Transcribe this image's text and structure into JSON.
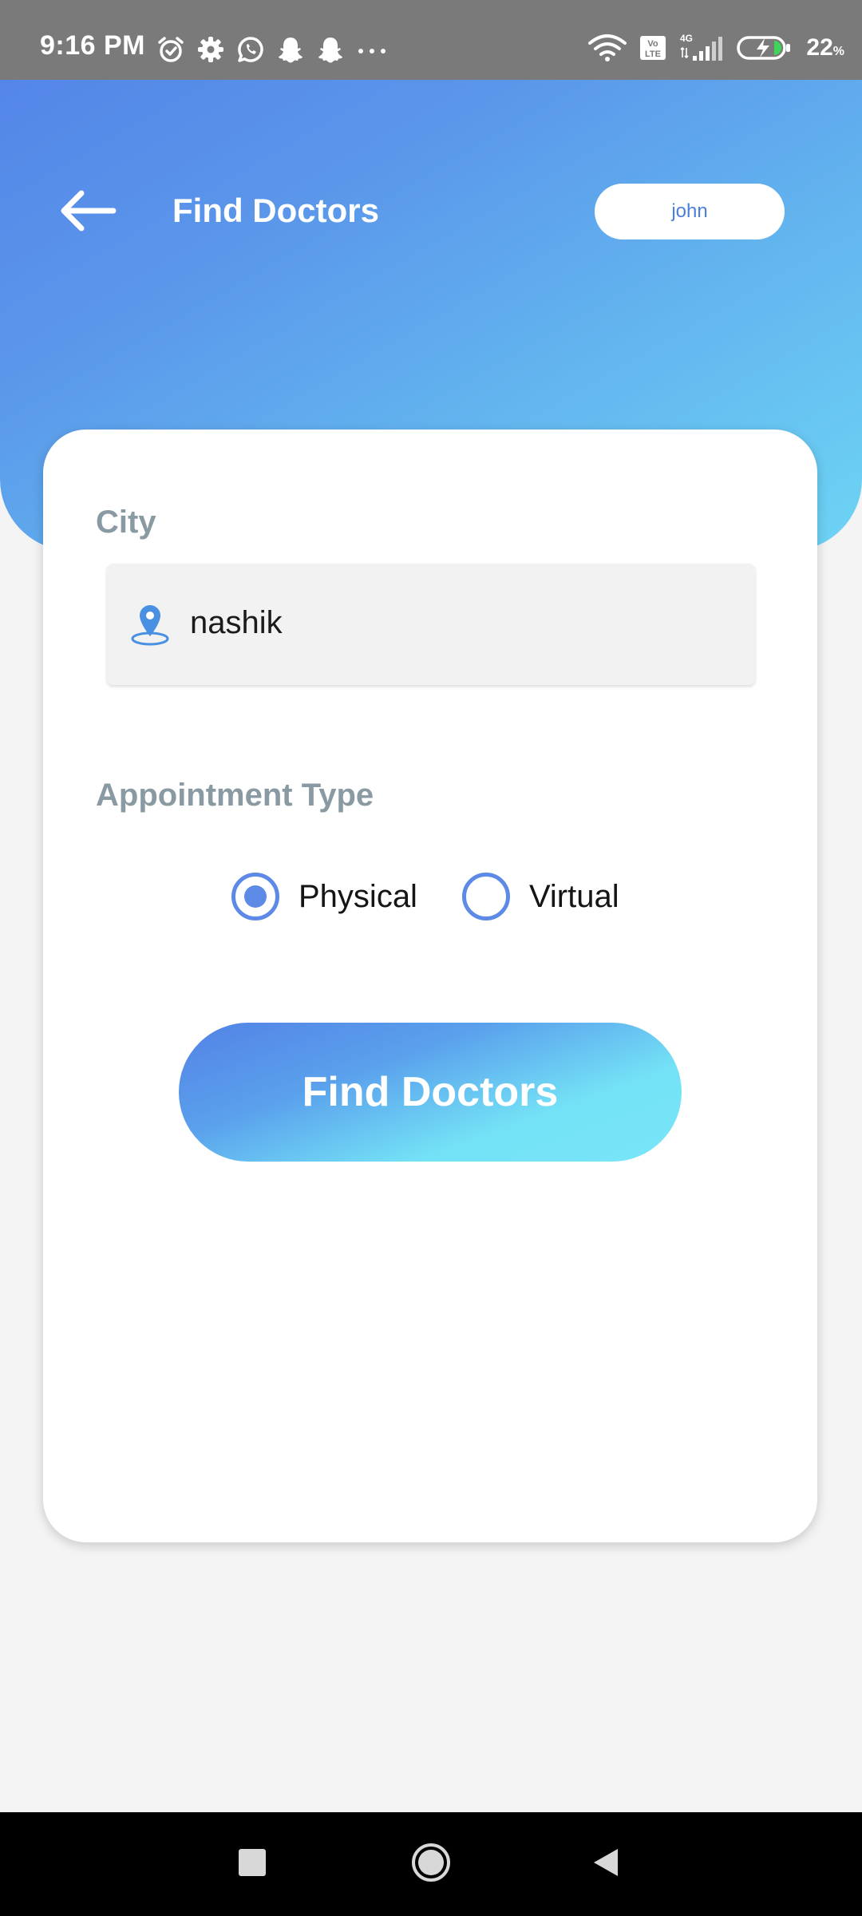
{
  "status_bar": {
    "time": "9:16 PM",
    "left_icons": [
      "alarm-icon",
      "settings-icon",
      "whatsapp-icon",
      "snapchat-icon",
      "snapchat-icon",
      "more-notifications-icon"
    ],
    "right_icons": [
      "wifi-icon",
      "volte-icon",
      "signal-4g-icon",
      "battery-charging-icon"
    ],
    "volte_text": "Vo LTE",
    "network_text": "4G",
    "battery_level": "22",
    "battery_unit": "%"
  },
  "header": {
    "back_icon": "arrow-left-icon",
    "title": "Find Doctors",
    "user_name": "john"
  },
  "form": {
    "city_label": "City",
    "city_value": "nashik",
    "city_icon": "location-pin-icon",
    "appointment_label": "Appointment Type",
    "options": [
      {
        "label": "Physical",
        "checked": true
      },
      {
        "label": "Virtual",
        "checked": false
      }
    ],
    "submit_label": "Find Doctors"
  },
  "nav_bar": {
    "buttons": [
      "recents-icon",
      "home-icon",
      "back-icon"
    ]
  },
  "colors": {
    "accent": "#5c8ae6",
    "header_gradient_start": "#5486e8",
    "header_gradient_end": "#6dd4f4",
    "button_gradient_end": "#78e6f7",
    "label_gray": "#8a9aa3",
    "field_bg": "#f2f2f2",
    "status_bar": "#7a7a7a",
    "nav_bar": "#000000"
  }
}
